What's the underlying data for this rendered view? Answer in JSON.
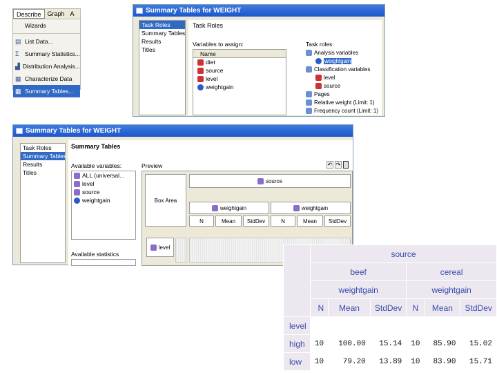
{
  "menu": {
    "menubar": [
      "Describe",
      "Graph",
      "A"
    ],
    "items": [
      {
        "label": "Wizards",
        "icon": "none"
      },
      {
        "label": "List Data...",
        "icon": "list-icon"
      },
      {
        "label": "Summary Statistics...",
        "icon": "sigma-icon"
      },
      {
        "label": "Distribution Analysis...",
        "icon": "histogram-icon"
      },
      {
        "label": "Characterize Data",
        "icon": "characterize-icon"
      },
      {
        "label": "Summary Tables...",
        "icon": "table-icon"
      }
    ],
    "selected_index": 5
  },
  "window1": {
    "title": "Summary Tables for WEIGHT",
    "nav": [
      "Task Roles",
      "Summary Tables",
      "Results",
      "Titles"
    ],
    "nav_selected": 0,
    "heading": "Task Roles",
    "variables_label": "Variables to assign:",
    "list_header": "Name",
    "variables": [
      "diet",
      "source",
      "level",
      "weightgain"
    ],
    "roles_label": "Task roles:",
    "roles": [
      {
        "label": "Analysis variables",
        "level": 0
      },
      {
        "label": "weightgain",
        "level": 1,
        "selected": true
      },
      {
        "label": "Classification variables",
        "level": 0
      },
      {
        "label": "level",
        "level": 1
      },
      {
        "label": "source",
        "level": 1
      },
      {
        "label": "Pages",
        "level": 0
      },
      {
        "label": "Relative weight (Limit: 1)",
        "level": 0
      },
      {
        "label": "Frequency count (Limit: 1)",
        "level": 0
      }
    ]
  },
  "window2": {
    "title": "Summary Tables for WEIGHT",
    "nav": [
      "Task Roles",
      "Summary Tables",
      "Results",
      "Titles"
    ],
    "nav_selected": 1,
    "heading": "Summary Tables",
    "available_variables_label": "Available variables:",
    "available_variables": [
      "ALL (universal...",
      "level",
      "source",
      "weightgain"
    ],
    "available_statistics_label": "Available statistics",
    "preview_label": "Preview",
    "box_area": "Box Area",
    "col_class": "source",
    "analysis_vars": [
      "weightgain",
      "weightgain"
    ],
    "stats": [
      "N",
      "Mean",
      "StdDev",
      "N",
      "Mean",
      "StdDev"
    ],
    "row_class": "level"
  },
  "output": {
    "col_class": "source",
    "groups": [
      "beef",
      "cereal"
    ],
    "analysis_var": "weightgain",
    "stats": [
      "N",
      "Mean",
      "StdDev",
      "N",
      "Mean",
      "StdDev"
    ],
    "row_class": "level",
    "rows": [
      {
        "label": "high",
        "values": [
          "10",
          "100.00",
          "15.14",
          "10",
          "85.90",
          "15.02"
        ]
      },
      {
        "label": "low",
        "values": [
          "10",
          "79.20",
          "13.89",
          "10",
          "83.90",
          "15.71"
        ]
      }
    ]
  }
}
